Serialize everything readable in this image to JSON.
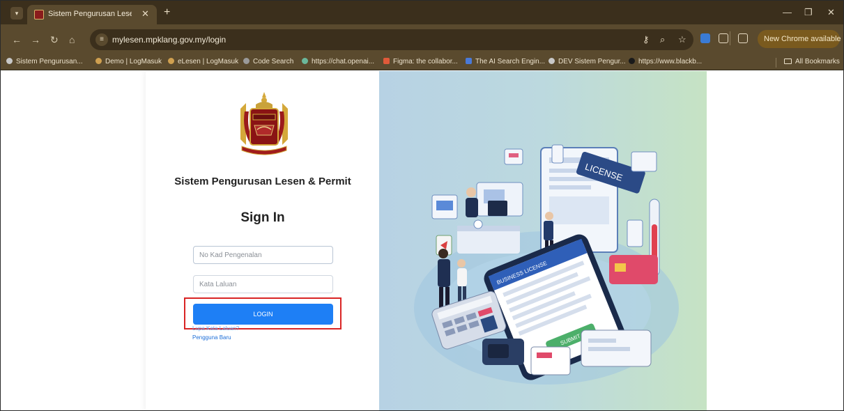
{
  "browser": {
    "tab_title": "Sistem Pengurusan Lesen & Per",
    "url": "mylesen.mpklang.gov.my/login",
    "update_label": "New Chrome available",
    "bookmarks": [
      "Sistem Pengurusan...",
      "Demo | LogMasuk",
      "eLesen | LogMasuk",
      "Code Search",
      "https://chat.openai...",
      "Figma: the collabor...",
      "The AI Search Engin...",
      "DEV Sistem Pengur...",
      "https://www.blackb..."
    ],
    "all_bookmarks": "All Bookmarks"
  },
  "page": {
    "system_title": "Sistem Pengurusan Lesen & Permit",
    "heading": "Sign In",
    "id_placeholder": "No Kad Pengenalan",
    "password_placeholder": "Kata Laluan",
    "login_label": "LOGIN",
    "forgot_label": "Lupa Kata Laluan?",
    "new_user_label": "Pengguna Baru",
    "license_tag": "LICENSE",
    "business_label": "BUSINESS LICENSE",
    "submit_label": "SUBMIT"
  },
  "colors": {
    "accent": "#1e7ff5",
    "highlight": "#d92424",
    "browser_frame": "#5a4a2e"
  }
}
